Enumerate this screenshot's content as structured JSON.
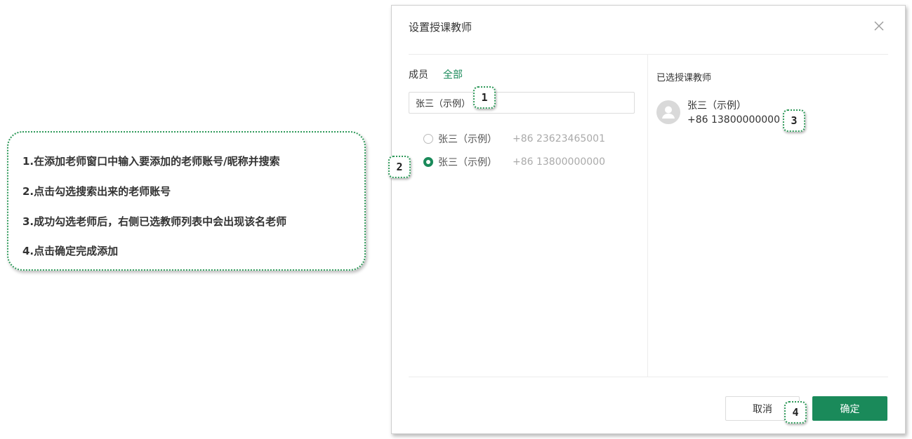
{
  "instructions": [
    "1.在添加老师窗口中输入要添加的老师账号/昵称并搜索",
    "2.点击勾选搜索出来的老师账号",
    "3.成功勾选老师后，右侧已选教师列表中会出现该名老师",
    "4.点击确定完成添加"
  ],
  "dialog": {
    "title": "设置授课教师",
    "close_icon": "close-icon",
    "tabs": {
      "members": "成员",
      "all": "全部"
    },
    "search_value": "张三（示例）",
    "members": [
      {
        "name": "张三（示例）",
        "phone": "+86 23623465001",
        "selected": false
      },
      {
        "name": "张三（示例）",
        "phone": "+86 13800000000",
        "selected": true
      }
    ],
    "selected_title": "已选授课教师",
    "selected": {
      "name": "张三（示例）",
      "phone": "+86 13800000000",
      "avatar_icon": "user-avatar-icon"
    },
    "buttons": {
      "cancel": "取消",
      "ok": "确定"
    }
  },
  "markers": [
    "1",
    "2",
    "3",
    "4"
  ],
  "colors": {
    "accent": "#1a8a5a",
    "callout_border": "#2f9a5a"
  }
}
